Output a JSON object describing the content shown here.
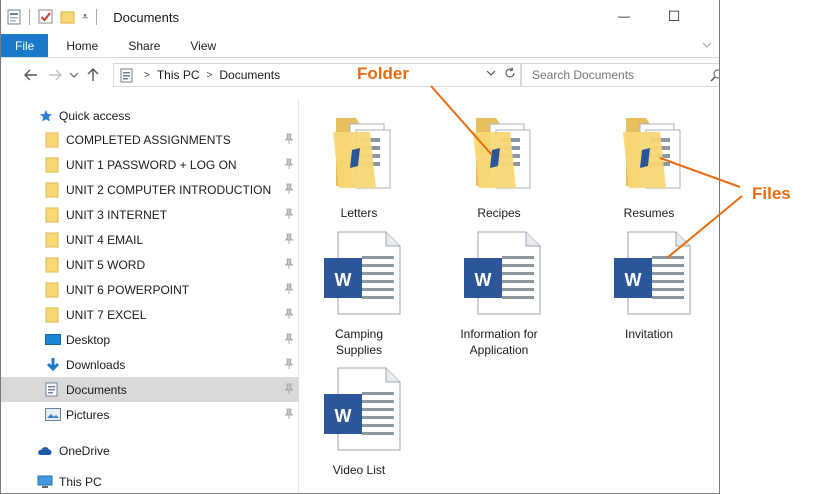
{
  "window": {
    "title": "Documents",
    "min_glyph": "—",
    "max_glyph": "☐",
    "close_glyph": "✕"
  },
  "ribbon": {
    "tabs": [
      "File",
      "Home",
      "Share",
      "View"
    ]
  },
  "address": {
    "crumbs": [
      "This PC",
      "Documents"
    ],
    "search_placeholder": "Search Documents"
  },
  "nav": {
    "quick_access": "Quick access",
    "items": [
      {
        "label": "COMPLETED ASSIGNMENTS",
        "icon": "folder-icon"
      },
      {
        "label": "UNIT 1 PASSWORD + LOG ON",
        "icon": "folder-icon"
      },
      {
        "label": "UNIT 2 COMPUTER INTRODUCTION",
        "icon": "folder-icon"
      },
      {
        "label": "UNIT 3 INTERNET",
        "icon": "folder-icon"
      },
      {
        "label": "UNIT 4 EMAIL",
        "icon": "folder-icon"
      },
      {
        "label": "UNIT 5  WORD",
        "icon": "folder-icon"
      },
      {
        "label": "UNIT 6 POWERPOINT",
        "icon": "folder-icon"
      },
      {
        "label": "UNIT 7 EXCEL",
        "icon": "folder-icon"
      },
      {
        "label": "Desktop",
        "icon": "desktop-icon"
      },
      {
        "label": "Downloads",
        "icon": "downloads-icon"
      },
      {
        "label": "Documents",
        "icon": "documents-icon"
      },
      {
        "label": "Pictures",
        "icon": "pictures-icon"
      }
    ],
    "onedrive": "OneDrive",
    "thispc": "This PC"
  },
  "content": {
    "folders": [
      "Letters",
      "Recipes",
      "Resumes"
    ],
    "files": [
      {
        "line1": "Camping",
        "line2": "Supplies"
      },
      {
        "line1": "Information for",
        "line2": "Application"
      },
      {
        "line1": "Invitation",
        "line2": ""
      },
      {
        "line1": "Video List",
        "line2": ""
      }
    ],
    "word_glyph": "W"
  },
  "annotations": {
    "folder": "Folder",
    "files": "Files"
  },
  "colors": {
    "accent": "#1979ca",
    "annotation": "#e86b10",
    "folder": "#f8d775",
    "word": "#2b579a"
  }
}
